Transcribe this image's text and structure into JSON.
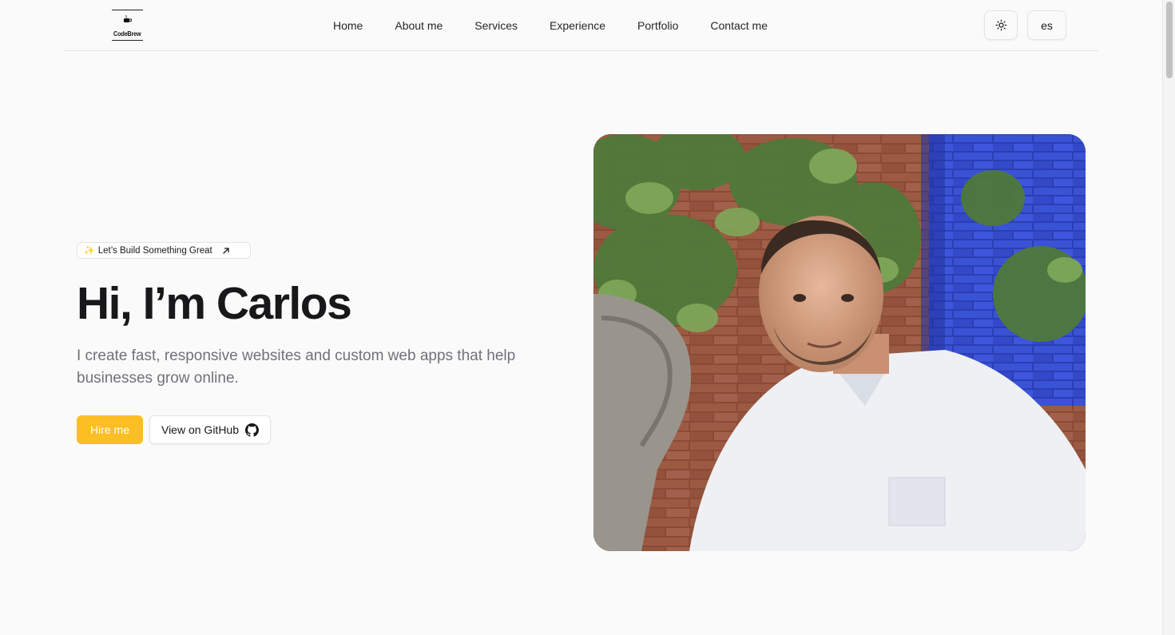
{
  "header": {
    "logo_text": "CodeBrew",
    "nav": [
      {
        "label": "Home"
      },
      {
        "label": "About me"
      },
      {
        "label": "Services"
      },
      {
        "label": "Experience"
      },
      {
        "label": "Portfolio"
      },
      {
        "label": "Contact me"
      }
    ],
    "theme_icon": "sun-icon",
    "lang_label": "es"
  },
  "hero": {
    "badge_icon": "sparkles-icon",
    "badge_label": "Let’s Build Something Great",
    "badge_arrow_icon": "arrow-up-right-icon",
    "title": "Hi, I’m Carlos",
    "subtitle": "I create fast, responsive websites and custom web apps that help businesses grow online.",
    "hire_label": "Hire me",
    "github_label": "View on GitHub",
    "github_icon": "github-icon",
    "photo_alt": "Carlos portrait"
  },
  "colors": {
    "accent": "#fbbf24",
    "background": "#fafafa",
    "text": "#18181b",
    "muted": "#71717a",
    "border": "#e4e4e7"
  }
}
